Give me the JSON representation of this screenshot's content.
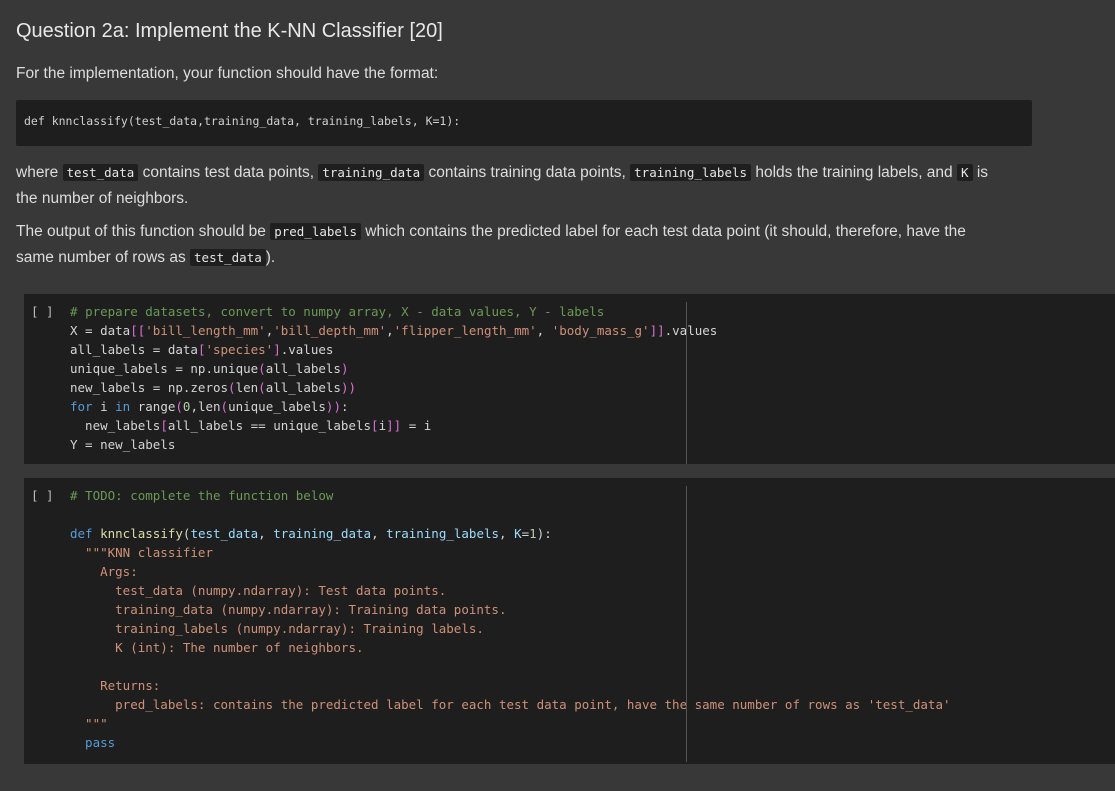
{
  "markdown": {
    "heading": "Question 2a: Implement the K-NN Classifier [20]",
    "intro": "For the implementation, your function should have the format:",
    "signature": "def knnclassify(test_data,training_data, training_labels, K=1):",
    "p1": {
      "t1": "where ",
      "c1": "test_data",
      "t2": " contains test data points, ",
      "c2": "training_data",
      "t3": " contains training data points, ",
      "c3": "training_labels",
      "t4": " holds the training labels, and ",
      "c4": "K",
      "t5": " is",
      "t6": "the number of neighbors."
    },
    "p2": {
      "t1": "The output of this function should be ",
      "c1": "pred_labels",
      "t2": " which contains the predicted label for each test data point (it should, therefore, have the",
      "t3": "same number of rows as ",
      "c2": "test_data",
      "t4": ")."
    }
  },
  "cells": [
    {
      "run_indicator": "[ ]",
      "lines": [
        "# prepare datasets, convert to numpy array, X - data values, Y - labels",
        "X = data[['bill_length_mm','bill_depth_mm','flipper_length_mm', 'body_mass_g']].values",
        "all_labels = data['species'].values",
        "unique_labels = np.unique(all_labels)",
        "new_labels = np.zeros(len(all_labels))",
        "for i in range(0,len(unique_labels)):",
        "  new_labels[all_labels == unique_labels[i]] = i",
        "Y = new_labels"
      ]
    },
    {
      "run_indicator": "[ ]",
      "lines": [
        "# TODO: complete the function below",
        "",
        "def knnclassify(test_data, training_data, training_labels, K=1):",
        "  \"\"\"KNN classifier",
        "    Args:",
        "      test_data (numpy.ndarray): Test data points.",
        "      training_data (numpy.ndarray): Training data points.",
        "      training_labels (numpy.ndarray): Training labels.",
        "      K (int): The number of neighbors.",
        "",
        "    Returns:",
        "      pred_labels: contains the predicted label for each test data point, have the same number of rows as 'test_data'",
        "  \"\"\"",
        "  pass"
      ]
    }
  ]
}
